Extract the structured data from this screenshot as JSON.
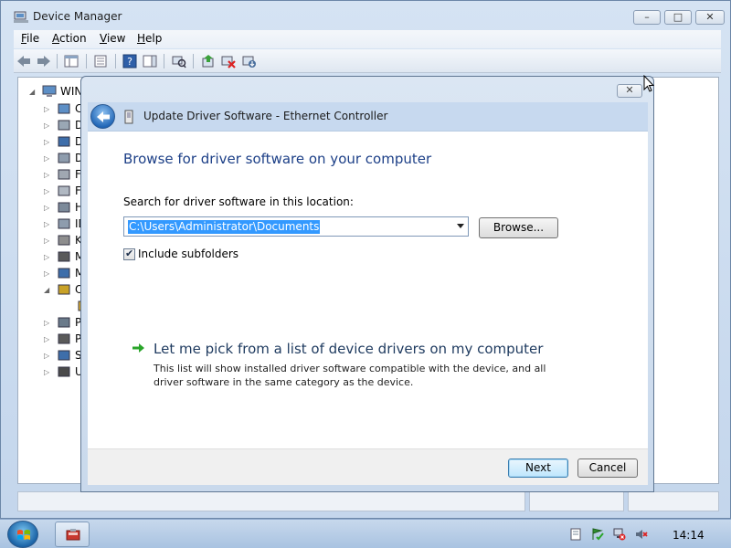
{
  "device_manager": {
    "title": "Device Manager",
    "menu": [
      "File",
      "Action",
      "View",
      "Help"
    ],
    "menu_accel": [
      "F",
      "A",
      "V",
      "H"
    ],
    "menu_rest": [
      "ile",
      "ction",
      "iew",
      "elp"
    ],
    "tree_root_label": "WIN-",
    "tree_items": [
      {
        "letter": "C",
        "icon": "computer-icon"
      },
      {
        "letter": "D",
        "icon": "disk-drive-icon"
      },
      {
        "letter": "D",
        "icon": "display-adapter-icon"
      },
      {
        "letter": "D",
        "icon": "dvd-drive-icon"
      },
      {
        "letter": "F",
        "icon": "floppy-controller-icon"
      },
      {
        "letter": "F",
        "icon": "floppy-drive-icon"
      },
      {
        "letter": "H",
        "icon": "hid-icon"
      },
      {
        "letter": "ID",
        "icon": "ide-controller-icon"
      },
      {
        "letter": "K",
        "icon": "keyboard-icon"
      },
      {
        "letter": "M",
        "icon": "mouse-icon"
      },
      {
        "letter": "M",
        "icon": "monitor-icon"
      },
      {
        "letter": "O",
        "icon": "other-devices-icon"
      },
      {
        "letter": "",
        "icon": "unknown-device-icon"
      },
      {
        "letter": "P",
        "icon": "port-icon"
      },
      {
        "letter": "P",
        "icon": "processor-icon"
      },
      {
        "letter": "S",
        "icon": "system-devices-icon"
      },
      {
        "letter": "U",
        "icon": "usb-controller-icon"
      }
    ]
  },
  "dialog": {
    "header_title": "Update Driver Software - Ethernet Controller",
    "heading": "Browse for driver software on your computer",
    "search_label": "Search for driver software in this location:",
    "path_value": "C:\\Users\\Administrator\\Documents",
    "browse_label": "Browse...",
    "include_subfolders_label": "Include subfolders",
    "include_subfolders_checked": true,
    "link_title": "Let me pick from a list of device drivers on my computer",
    "link_desc": "This list will show installed driver software compatible with the device, and all driver software in the same category as the device.",
    "next_label": "Next",
    "cancel_label": "Cancel"
  },
  "taskbar": {
    "clock": "14:14"
  },
  "colors": {
    "heading": "#1c3f87",
    "selection": "#3399ff",
    "link_arrow": "#2aa52a"
  }
}
